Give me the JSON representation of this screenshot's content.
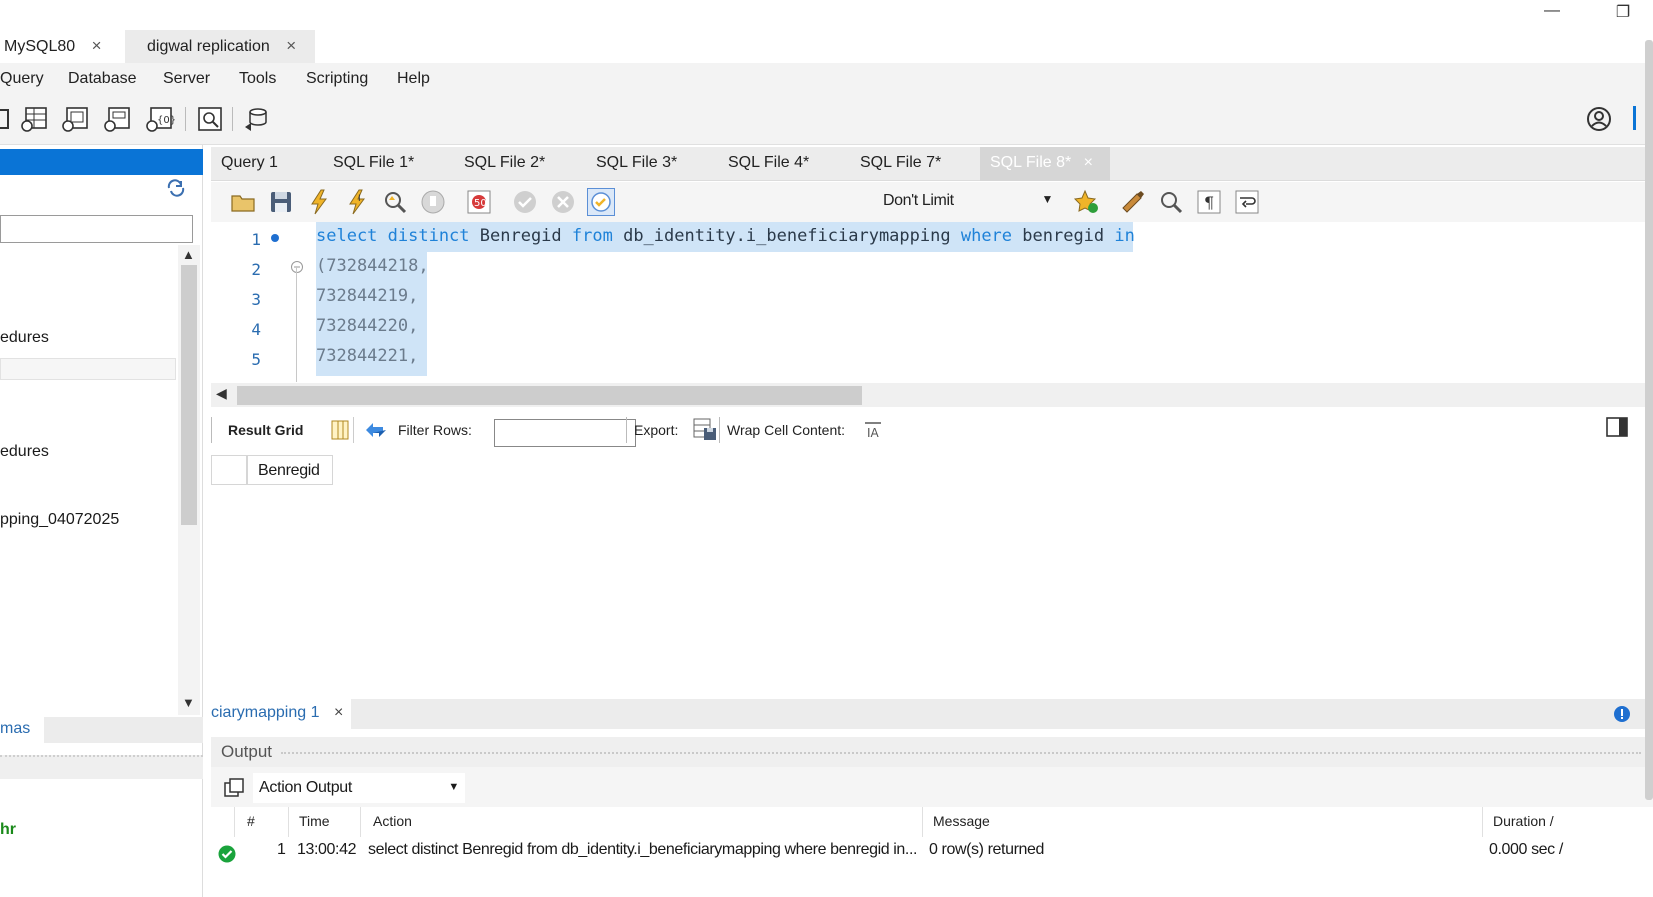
{
  "connection_tabs": [
    {
      "label": "MySQL80",
      "close": "×"
    },
    {
      "label": "digwal replication",
      "close": "×"
    }
  ],
  "window_controls": {
    "minimize": "—",
    "restore": "❐"
  },
  "menu": [
    "Query",
    "Database",
    "Server",
    "Tools",
    "Scripting",
    "Help"
  ],
  "navigator": {
    "items": [
      "edures",
      "edures",
      "pping_04072025",
      "mas",
      "hr"
    ]
  },
  "editor_tabs": [
    "Query 1",
    "SQL File 1*",
    "SQL File 2*",
    "SQL File 3*",
    "SQL File 4*",
    "SQL File 7*",
    "SQL File 8*"
  ],
  "editor_toolbar": {
    "limit_value": "Don't Limit"
  },
  "code": {
    "line_numbers": [
      "1",
      "2",
      "3",
      "4",
      "5"
    ],
    "line1": {
      "k1": "select distinct",
      "t1": " Benregid ",
      "k2": "from",
      "t2": " db_identity.i_beneficiarymapping ",
      "k3": "where",
      "t3": " benregid ",
      "k4": "in"
    },
    "lines": [
      "(732844218,",
      "732844219,",
      "732844220,",
      "732844221,"
    ]
  },
  "result_toolbar": {
    "result_grid": "Result Grid",
    "filter_rows": "Filter Rows:",
    "export": "Export:",
    "wrap": "Wrap Cell Content:"
  },
  "result_grid": {
    "columns": [
      "Benregid"
    ]
  },
  "result_tab": {
    "label": "ciarymapping 1",
    "close": "×"
  },
  "output": {
    "title": "Output",
    "selector": "Action Output",
    "columns": [
      "#",
      "Time",
      "Action",
      "Message",
      "Duration /"
    ],
    "rows": [
      {
        "num": "1",
        "time": "13:00:42",
        "action": "select distinct Benregid from db_identity.i_beneficiarymapping where benregid in...",
        "message": "0 row(s) returned",
        "duration": "0.000 sec /"
      }
    ]
  },
  "colors": {
    "accent": "#0a74d6",
    "keyword": "#1f82d8",
    "selection": "#cfe4f7",
    "success": "#1aa33c"
  }
}
